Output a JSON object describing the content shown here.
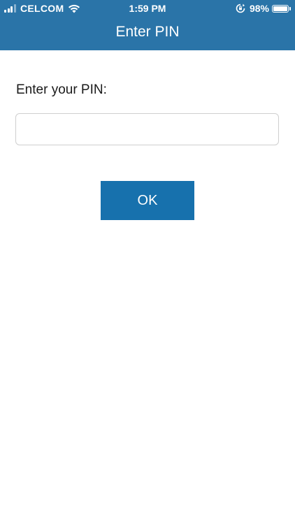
{
  "status_bar": {
    "carrier": "CELCOM",
    "time": "1:59 PM",
    "battery_percent": "98%",
    "battery_level": 0.98,
    "signal_bars": 3,
    "signal_bars_total": 4
  },
  "nav": {
    "title": "Enter PIN"
  },
  "form": {
    "pin_label": "Enter your PIN:",
    "pin_value": "",
    "ok_label": "OK"
  },
  "colors": {
    "header_bg": "#2a74a8",
    "button_bg": "#1771ad",
    "text": "#1a1a1a",
    "input_border": "#cfcfcf"
  }
}
